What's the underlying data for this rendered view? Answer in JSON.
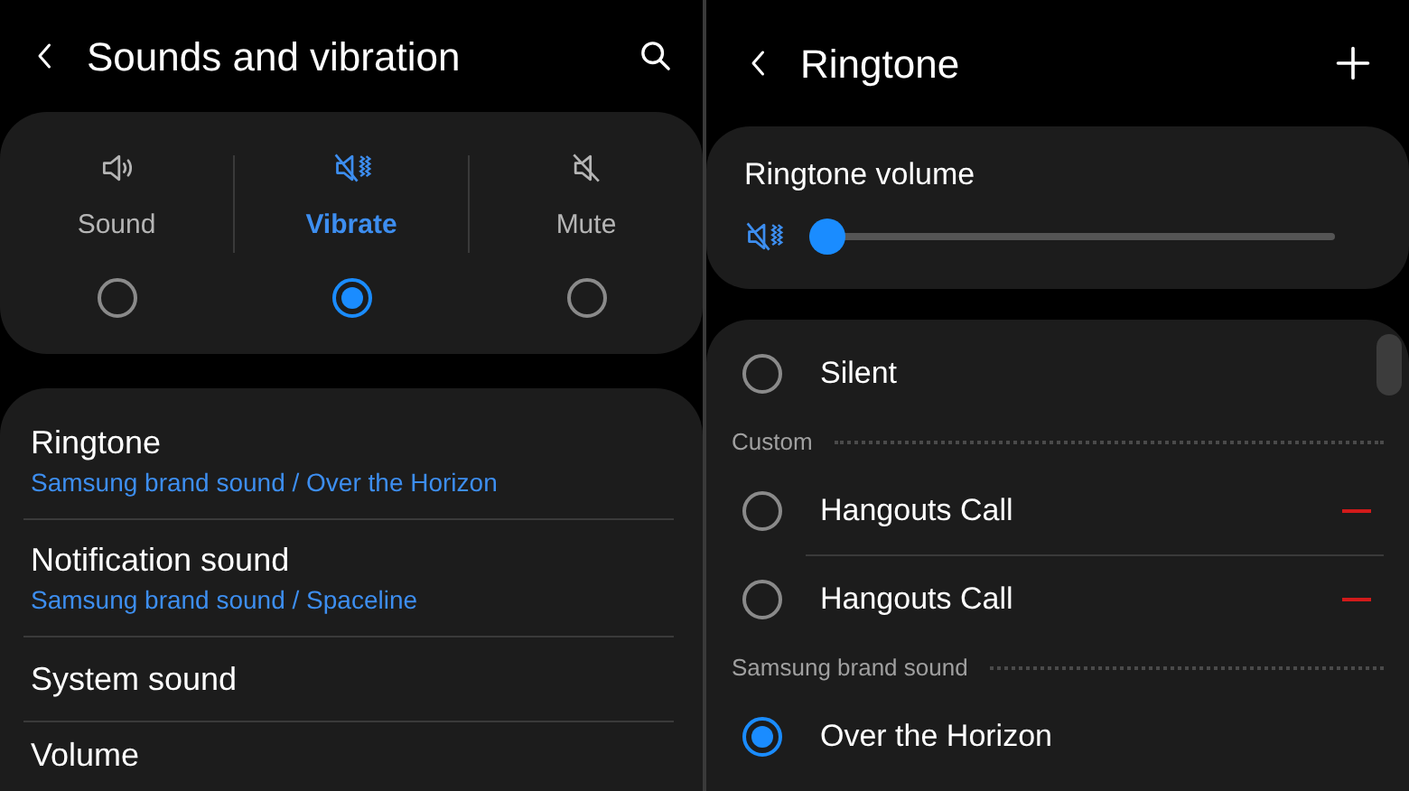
{
  "left": {
    "title": "Sounds and vibration",
    "modes": [
      {
        "kind": "sound",
        "label": "Sound",
        "selected": false
      },
      {
        "kind": "vibrate",
        "label": "Vibrate",
        "selected": true
      },
      {
        "kind": "mute",
        "label": "Mute",
        "selected": false
      }
    ],
    "settings": [
      {
        "title": "Ringtone",
        "subtitle": "Samsung brand sound / Over the Horizon"
      },
      {
        "title": "Notification sound",
        "subtitle": "Samsung brand sound / Spaceline"
      },
      {
        "title": "System sound"
      },
      {
        "title": "Volume"
      }
    ]
  },
  "right": {
    "title": "Ringtone",
    "volume": {
      "label": "Ringtone volume",
      "level": 0
    },
    "items": [
      {
        "kind": "option",
        "label": "Silent",
        "selected": false,
        "removable": false
      },
      {
        "kind": "header",
        "label": "Custom"
      },
      {
        "kind": "option",
        "label": "Hangouts Call",
        "selected": false,
        "removable": true
      },
      {
        "kind": "option",
        "label": "Hangouts Call",
        "selected": false,
        "removable": true
      },
      {
        "kind": "header",
        "label": "Samsung brand sound"
      },
      {
        "kind": "option",
        "label": "Over the Horizon",
        "selected": true,
        "removable": false
      }
    ]
  }
}
